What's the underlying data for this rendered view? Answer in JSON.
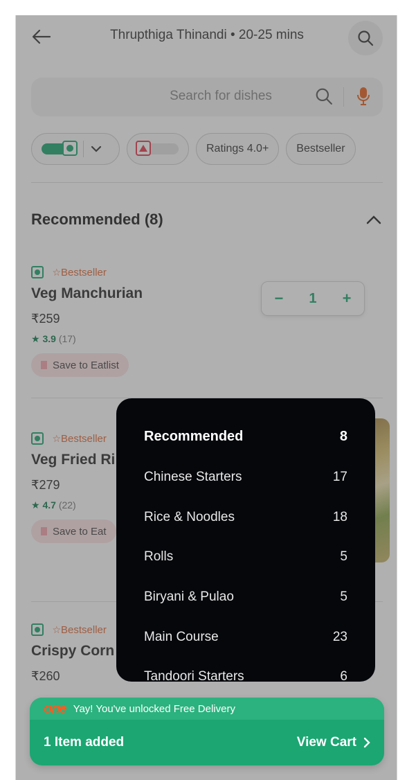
{
  "header": {
    "title": "Thrupthiga Thinandi • 20-25 mins"
  },
  "search": {
    "placeholder": "Search for dishes"
  },
  "filters": {
    "ratings_label": "Ratings 4.0+",
    "bestseller_label": "Bestseller"
  },
  "section": {
    "title": "Recommended (8)"
  },
  "dishes": [
    {
      "badge": "Bestseller",
      "name": "Veg Manchurian",
      "price": "₹259",
      "rating": "3.9",
      "rating_count": "(17)",
      "save_label": "Save to Eatlist",
      "quantity": "1"
    },
    {
      "badge": "Bestseller",
      "name": "Veg Fried Ri",
      "price": "₹279",
      "rating": "4.7",
      "rating_count": "(22)",
      "save_label": "Save to Eat"
    },
    {
      "badge": "Bestseller",
      "name": "Crispy Corn",
      "price": "₹260"
    }
  ],
  "menu": {
    "items": [
      {
        "label": "Recommended",
        "count": "8"
      },
      {
        "label": "Chinese Starters",
        "count": "17"
      },
      {
        "label": "Rice & Noodles",
        "count": "18"
      },
      {
        "label": "Rolls",
        "count": "5"
      },
      {
        "label": "Biryani & Pulao",
        "count": "5"
      },
      {
        "label": "Main Course",
        "count": "23"
      },
      {
        "label": "Tandoori Starters",
        "count": "6"
      }
    ]
  },
  "cart": {
    "brand": "one",
    "banner": "Yay! You've unlocked Free Delivery",
    "items_added": "1 Item added",
    "view_cart": "View Cart"
  },
  "colors": {
    "accent_green": "#1ba672",
    "bestseller": "#e06a3a",
    "brand_one": "#ff5a1f"
  }
}
